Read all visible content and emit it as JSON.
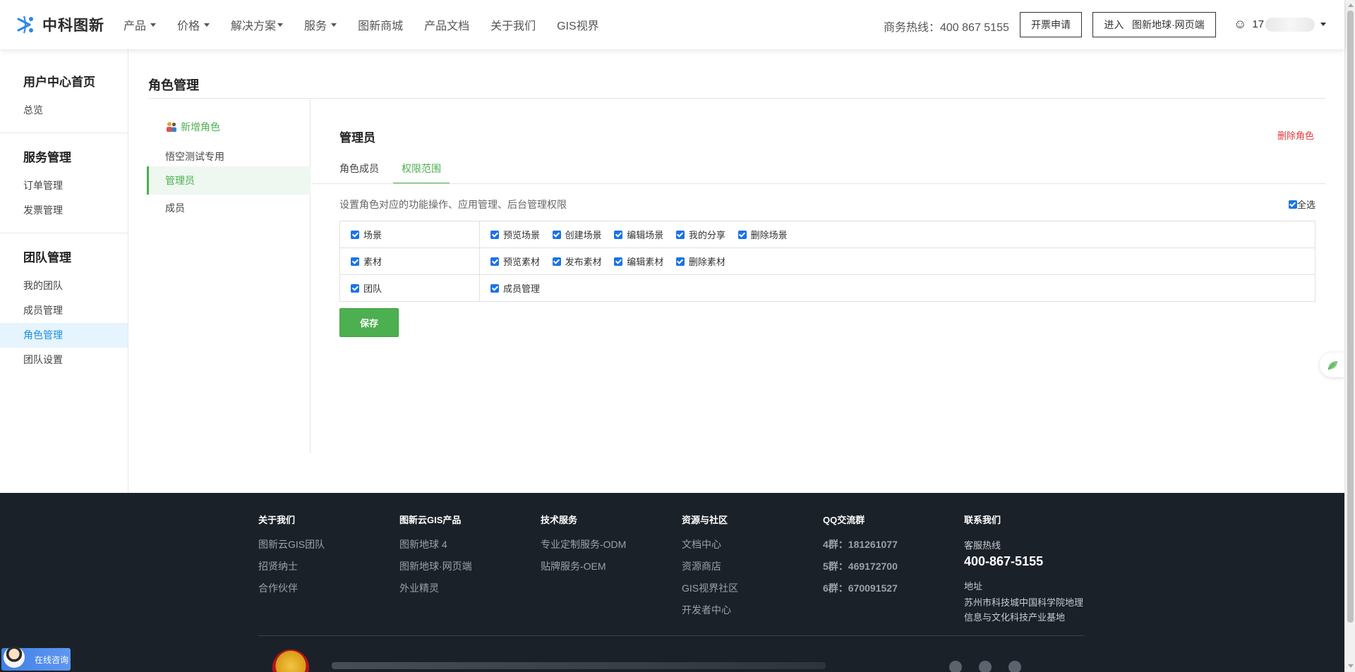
{
  "header": {
    "logo_text": "中科图新",
    "nav": [
      {
        "label": "产品",
        "dropdown": true
      },
      {
        "label": "价格",
        "dropdown": true
      },
      {
        "label": "解决方案",
        "dropdown": true
      },
      {
        "label": "服务",
        "dropdown": true
      },
      {
        "label": "图新商城",
        "dropdown": false
      },
      {
        "label": "产品文档",
        "dropdown": false
      },
      {
        "label": "关于我们",
        "dropdown": false
      },
      {
        "label": "GIS视界",
        "dropdown": false
      }
    ],
    "hotline": "商务热线：400 867 5155",
    "invoice_button": "开票申请",
    "enter_button": "进入   图新地球·网页端",
    "user_prefix": "17"
  },
  "sidebar": {
    "groups": [
      {
        "title": "用户中心首页",
        "items": [
          "总览"
        ]
      },
      {
        "title": "服务管理",
        "items": [
          "订单管理",
          "发票管理"
        ]
      },
      {
        "title": "团队管理",
        "items": [
          "我的团队",
          "成员管理",
          "角色管理",
          "团队设置"
        ]
      }
    ],
    "active_item": "角色管理"
  },
  "page": {
    "title": "角色管理",
    "add_role": "新增角色",
    "roles": [
      "悟空测试专用",
      "管理员",
      "成员"
    ],
    "active_role": "管理员"
  },
  "permissions": {
    "role_name": "管理员",
    "delete_role": "删除角色",
    "tabs": [
      "角色成员",
      "权限范围"
    ],
    "active_tab": "权限范围",
    "description": "设置角色对应的功能操作、应用管理、后台管理权限",
    "select_all": "全选",
    "modules": [
      {
        "name": "场景",
        "ops": [
          "预览场景",
          "创建场景",
          "编辑场景",
          "我的分享",
          "删除场景"
        ]
      },
      {
        "name": "素材",
        "ops": [
          "预览素材",
          "发布素材",
          "编辑素材",
          "删除素材"
        ]
      },
      {
        "name": "团队",
        "ops": [
          "成员管理"
        ]
      }
    ],
    "save_button": "保存"
  },
  "footer": {
    "columns": [
      {
        "title": "关于我们",
        "links": [
          "图新云GIS团队",
          "招贤纳士",
          "合作伙伴"
        ]
      },
      {
        "title": "图新云GIS产品",
        "links": [
          "图新地球 4",
          "图新地球·网页端",
          "外业精灵"
        ]
      },
      {
        "title": "技术服务",
        "links": [
          "专业定制服务-ODM",
          "贴牌服务-OEM"
        ]
      },
      {
        "title": "资源与社区",
        "links": [
          "文档中心",
          "资源商店",
          "GIS视界社区",
          "开发者中心"
        ]
      },
      {
        "title": "QQ交流群",
        "links": [
          "4群：181261077",
          "5群：469172700",
          "6群：670091527"
        ]
      }
    ],
    "contact": {
      "title": "联系我们",
      "hotline_label": "客服热线",
      "hotline": "400-867-5155",
      "address_label": "地址",
      "address": "苏州市科技城中国科学院地理信息与文化科技产业基地"
    }
  },
  "consult_button": "在线咨询",
  "colors": {
    "accent_green": "#4caf50",
    "active_blue": "#1f8fe0",
    "delete_red": "#e5383b",
    "footer_bg": "#1b2129"
  }
}
